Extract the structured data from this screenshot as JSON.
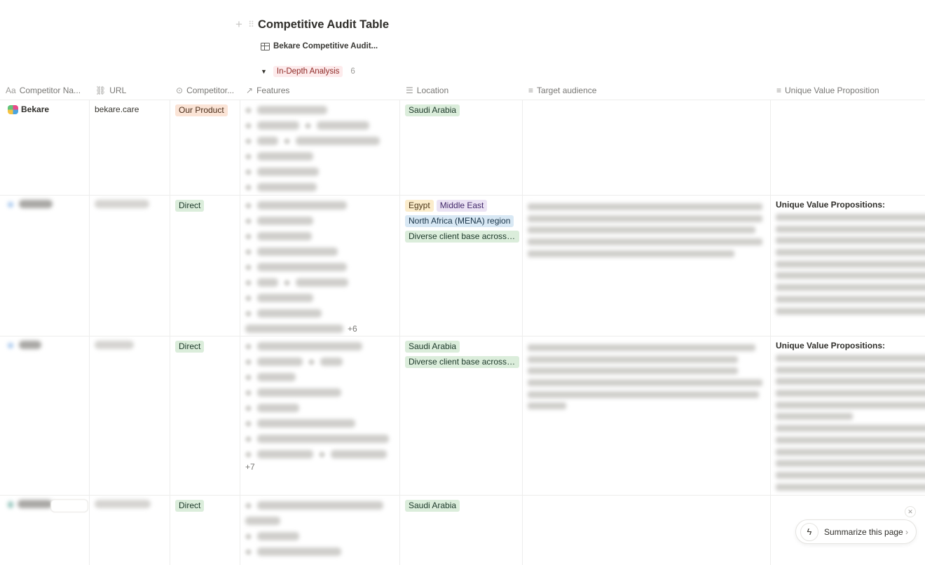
{
  "page": {
    "title": "Competitive Audit Table",
    "view_label": "Bekare Competitive Audit...",
    "group": {
      "label": "In-Depth Analysis",
      "count": "6"
    }
  },
  "columns": [
    {
      "label": "Competitor Na...",
      "icon": "title-icon",
      "glyph": "Aa"
    },
    {
      "label": "URL",
      "icon": "link-icon",
      "glyph": "🔗"
    },
    {
      "label": "Competitor...",
      "icon": "select-icon",
      "glyph": "⊙"
    },
    {
      "label": "Features",
      "icon": "relation-icon",
      "glyph": "↗"
    },
    {
      "label": "Location",
      "icon": "multi-select-icon",
      "glyph": "☰"
    },
    {
      "label": "Target audience",
      "icon": "text-icon",
      "glyph": "≡"
    },
    {
      "label": "Unique Value Proposition",
      "icon": "text-icon",
      "glyph": "≡"
    }
  ],
  "rows": [
    {
      "name": "Bekare",
      "url": "bekare.care",
      "competitor_type": "Our Product",
      "features_more": "",
      "locations": [
        "Saudi Arabia"
      ],
      "uvp_title": ""
    },
    {
      "name": "[blurred]",
      "url": "[blurred]",
      "competitor_type": "Direct",
      "features_more": "+6",
      "locations": [
        "Egypt",
        "Middle East",
        "North Africa (MENA) region",
        "Diverse client base across s..."
      ],
      "uvp_title": "Unique Value Propositions:"
    },
    {
      "name": "[blurred]",
      "url": "[blurred]",
      "competitor_type": "Direct",
      "features_more": "+7",
      "locations": [
        "Saudi Arabia",
        "Diverse client base across s..."
      ],
      "uvp_title": "Unique Value Propositions:"
    },
    {
      "name": "[blurred]",
      "url": "[blurred]",
      "competitor_type": "Direct",
      "features_more": "",
      "locations": [
        "Saudi Arabia"
      ],
      "uvp_title": ""
    }
  ],
  "summarize": {
    "label": "Summarize this page",
    "icon": "ai-assistant-icon"
  },
  "colors": {
    "group_tag_bg": "#fdebec",
    "our_product_bg": "#fbe4d6",
    "direct_bg": "#dbeddb"
  }
}
